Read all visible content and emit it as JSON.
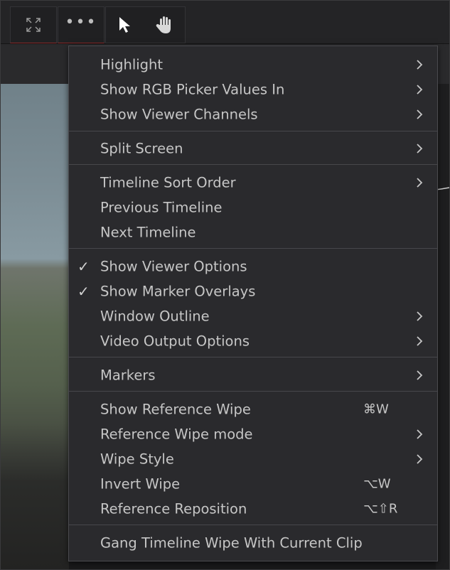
{
  "toolbar": {
    "fit_icon": "fit-to-screen-icon",
    "more_icon": "ellipsis-icon",
    "more_label": "•••",
    "pointer_icon": "pointer-arrow-icon",
    "hand_icon": "hand-pan-icon"
  },
  "menu": {
    "items": [
      {
        "label": "Highlight",
        "submenu": true
      },
      {
        "label": "Show RGB Picker Values In",
        "submenu": true
      },
      {
        "label": "Show Viewer Channels",
        "submenu": true
      },
      {
        "label": "Split Screen",
        "submenu": true
      },
      {
        "label": "Timeline Sort Order",
        "submenu": true
      },
      {
        "label": "Previous Timeline"
      },
      {
        "label": "Next Timeline"
      },
      {
        "label": "Show Viewer Options",
        "checked": true,
        "check": "✓"
      },
      {
        "label": "Show Marker Overlays",
        "checked": true,
        "check": "✓"
      },
      {
        "label": "Window Outline",
        "submenu": true
      },
      {
        "label": "Video Output Options",
        "submenu": true
      },
      {
        "label": "Markers",
        "submenu": true
      },
      {
        "label": "Show Reference Wipe",
        "shortcut": "⌘W"
      },
      {
        "label": "Reference Wipe mode",
        "submenu": true
      },
      {
        "label": "Wipe Style",
        "submenu": true
      },
      {
        "label": "Invert Wipe",
        "shortcut": "⌥W"
      },
      {
        "label": "Reference Reposition",
        "shortcut": "⌥⇧R"
      },
      {
        "label": "Gang Timeline Wipe With Current Clip"
      }
    ]
  },
  "colors": {
    "menu_bg": "#2a2a2d",
    "text": "#c6c6c6",
    "separator": "#47474b",
    "accent_underline": "#8a2a2a"
  }
}
